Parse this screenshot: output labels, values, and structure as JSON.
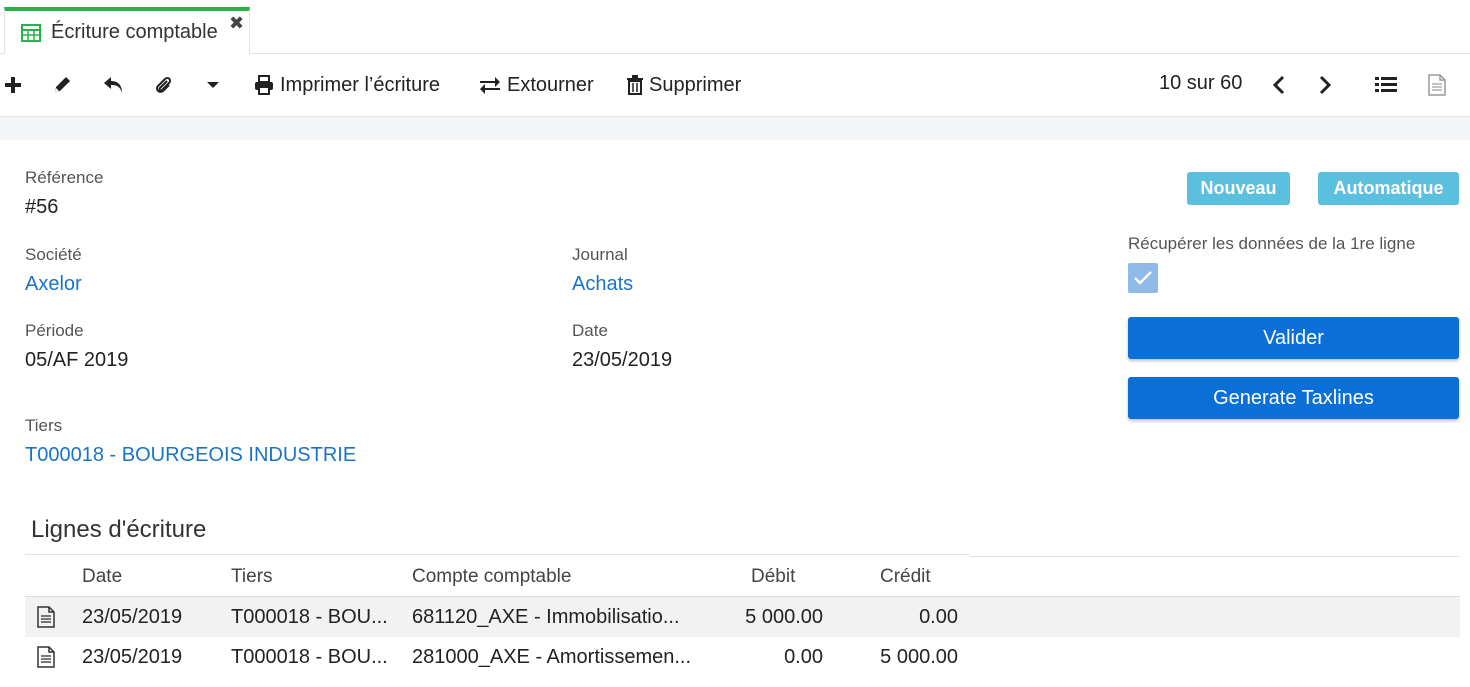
{
  "tab": {
    "title": "Écriture comptable",
    "close": "✖"
  },
  "toolbar": {
    "print_label": "Imprimer l’écriture",
    "reverse_label": "Extourner",
    "delete_label": "Supprimer",
    "pager": "10 sur 60"
  },
  "form": {
    "reference_label": "Référence",
    "reference_value": "#56",
    "company_label": "Société",
    "company_value": "Axelor",
    "journal_label": "Journal",
    "journal_value": "Achats",
    "period_label": "Période",
    "period_value": "05/AF 2019",
    "date_label": "Date",
    "date_value": "23/05/2019",
    "partner_label": "Tiers",
    "partner_value": "T000018 - BOURGEOIS INDUSTRIE",
    "badge_status": "Nouveau",
    "badge_type": "Automatique",
    "first_line_label": "Récupérer les données de la 1re ligne",
    "first_line_checked": true,
    "validate_label": "Valider",
    "taxlines_label": "Generate Taxlines"
  },
  "lines": {
    "title": "Lignes d'écriture",
    "headers": {
      "date": "Date",
      "partner": "Tiers",
      "account": "Compte comptable",
      "debit": "Débit",
      "credit": "Crédit"
    },
    "rows": [
      {
        "date": "23/05/2019",
        "partner": "T000018 - BOU...",
        "account": "681120_AXE - Immobilisatio...",
        "debit": "5 000.00",
        "credit": "0.00"
      },
      {
        "date": "23/05/2019",
        "partner": "T000018 - BOU...",
        "account": "281000_AXE - Amortissemen...",
        "debit": "0.00",
        "credit": "5 000.00"
      }
    ]
  },
  "colors": {
    "tab_accent": "#2bb14b",
    "link": "#1a73c8",
    "primary": "#0a6fd6",
    "badge": "#5bc0de",
    "checkbox": "#8fb9e6"
  }
}
